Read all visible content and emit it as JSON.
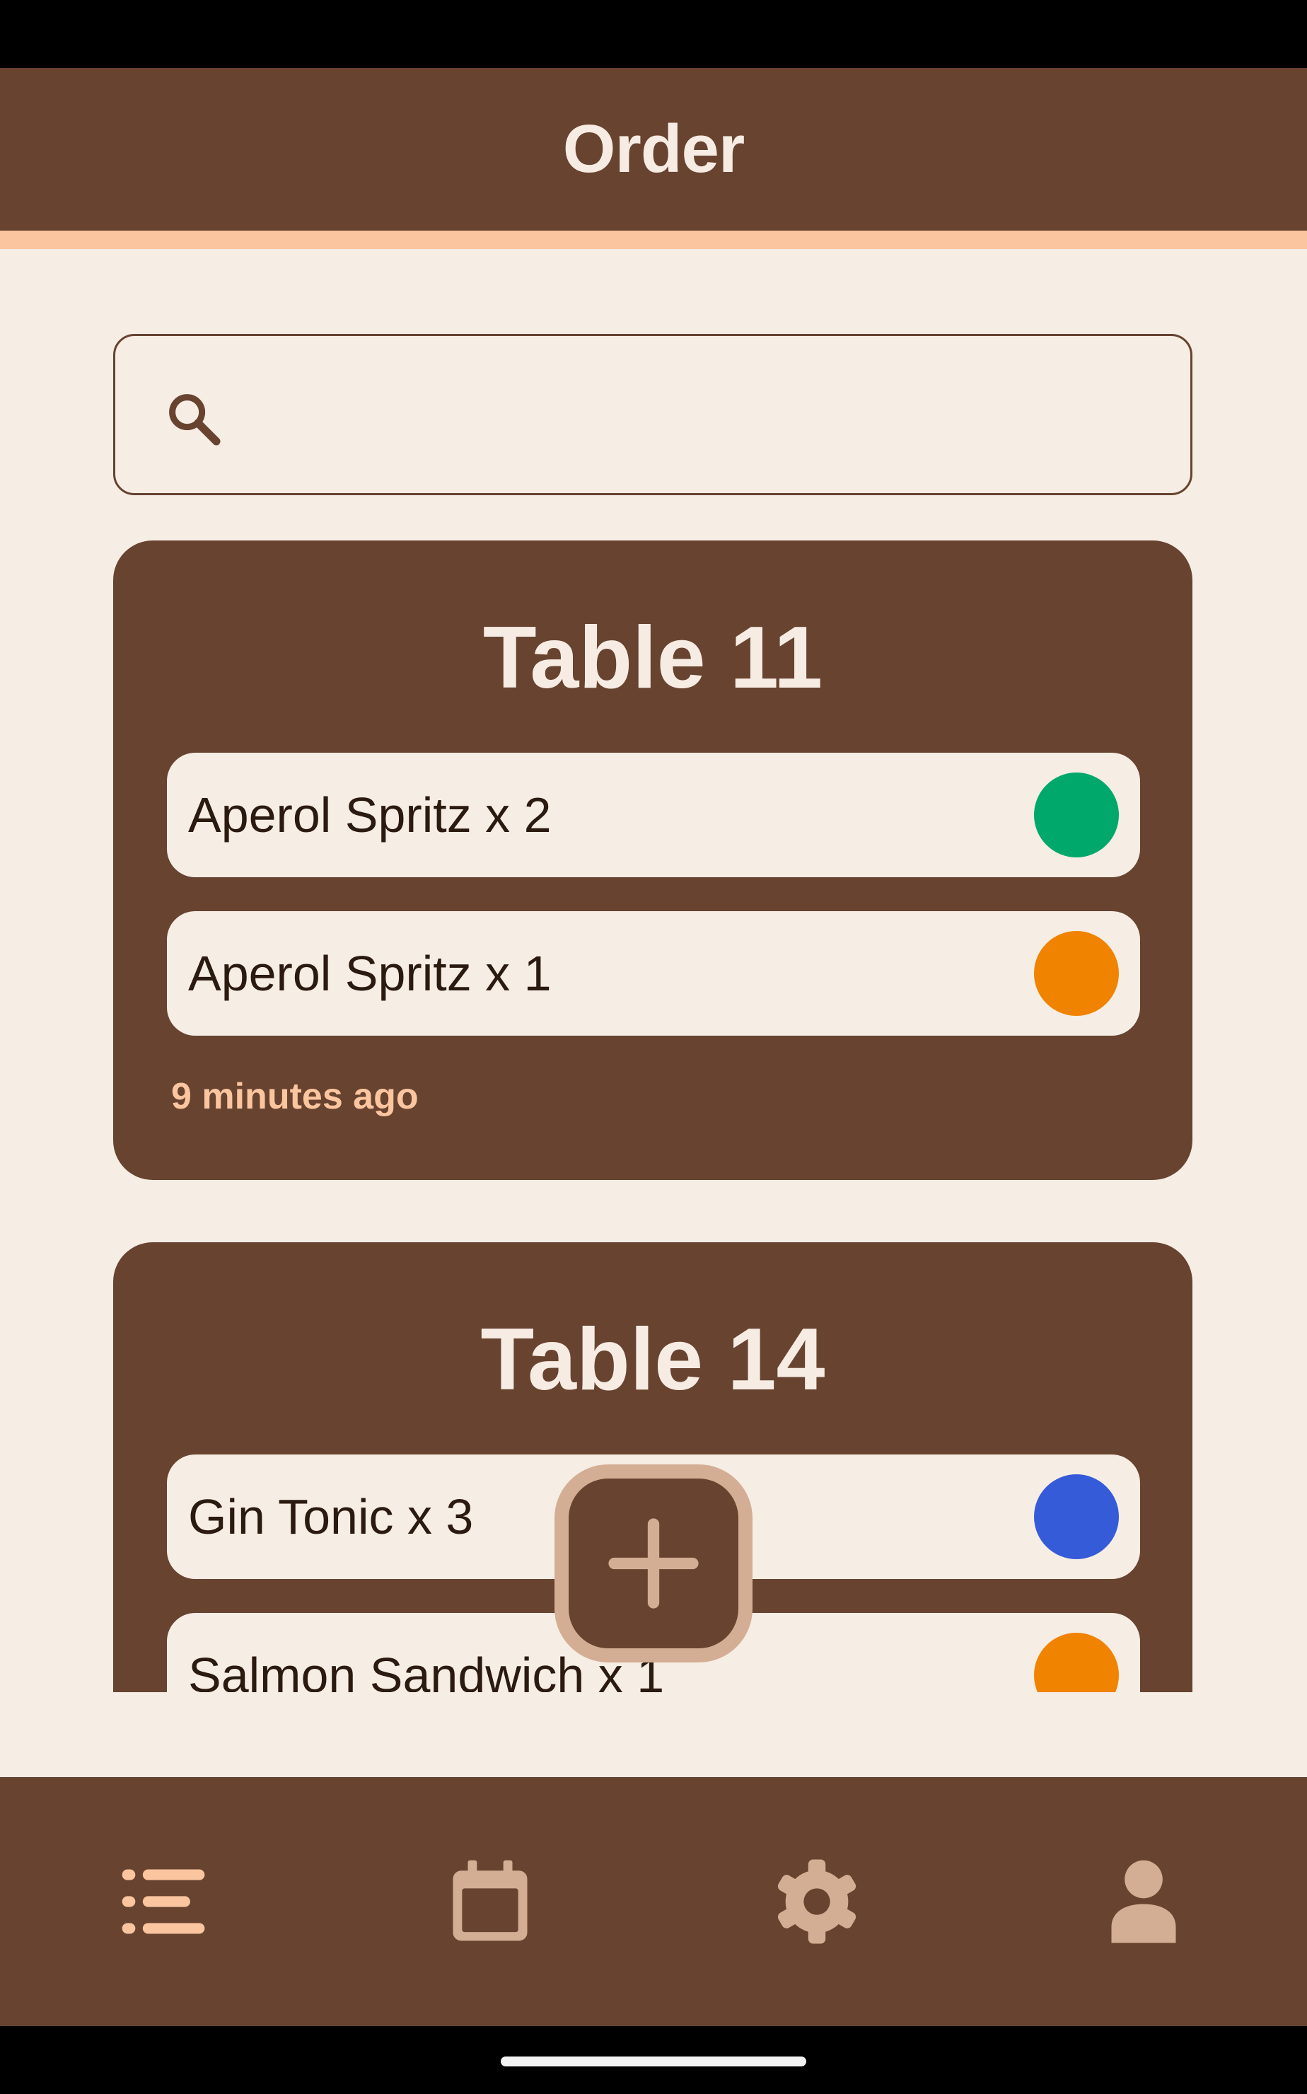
{
  "app_bar": {
    "title": "Order"
  },
  "search": {
    "value": "",
    "placeholder": "",
    "icon": "search-icon"
  },
  "orders": [
    {
      "table": "Table 11",
      "items": [
        {
          "label": "Aperol Spritz x 2",
          "status_color": "#00a86b"
        },
        {
          "label": "Aperol Spritz x 1",
          "status_color": "#f08300"
        }
      ],
      "time": "9 minutes ago"
    },
    {
      "table": "Table 14",
      "items": [
        {
          "label": "Gin Tonic x 3",
          "status_color": "#355bd8"
        },
        {
          "label": "Salmon Sandwich x 1",
          "status_color": "#f08300"
        }
      ]
    }
  ],
  "fab": {
    "icon": "plus-icon"
  },
  "bottom_nav": {
    "items": [
      {
        "icon": "list-icon",
        "active": true
      },
      {
        "icon": "calendar-icon",
        "active": false
      },
      {
        "icon": "gear-icon",
        "active": false
      },
      {
        "icon": "person-icon",
        "active": false
      }
    ]
  },
  "colors": {
    "primary": "#674330",
    "background": "#f6ede4",
    "accent": "#fbc59f",
    "inactive_icon": "#d4ae94",
    "status_served": "#00a86b",
    "status_pending": "#f08300",
    "status_new": "#355bd8"
  }
}
